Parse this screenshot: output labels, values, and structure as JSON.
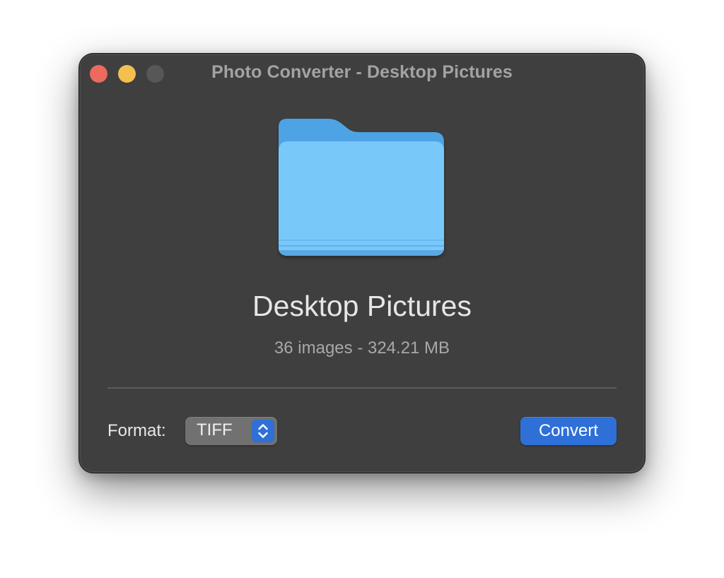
{
  "window": {
    "title": "Photo Converter - Desktop Pictures"
  },
  "folder": {
    "icon": "folder-icon",
    "name": "Desktop Pictures",
    "info": "36 images - 324.21 MB"
  },
  "footer": {
    "format_label": "Format:",
    "format_value": "TIFF",
    "convert_label": "Convert"
  },
  "colors": {
    "window_bg": "#3f3f3f",
    "accent": "#2e6fd8",
    "close": "#ec6a5e",
    "minimize": "#f4bf4f",
    "folder": "#78c9fa"
  }
}
